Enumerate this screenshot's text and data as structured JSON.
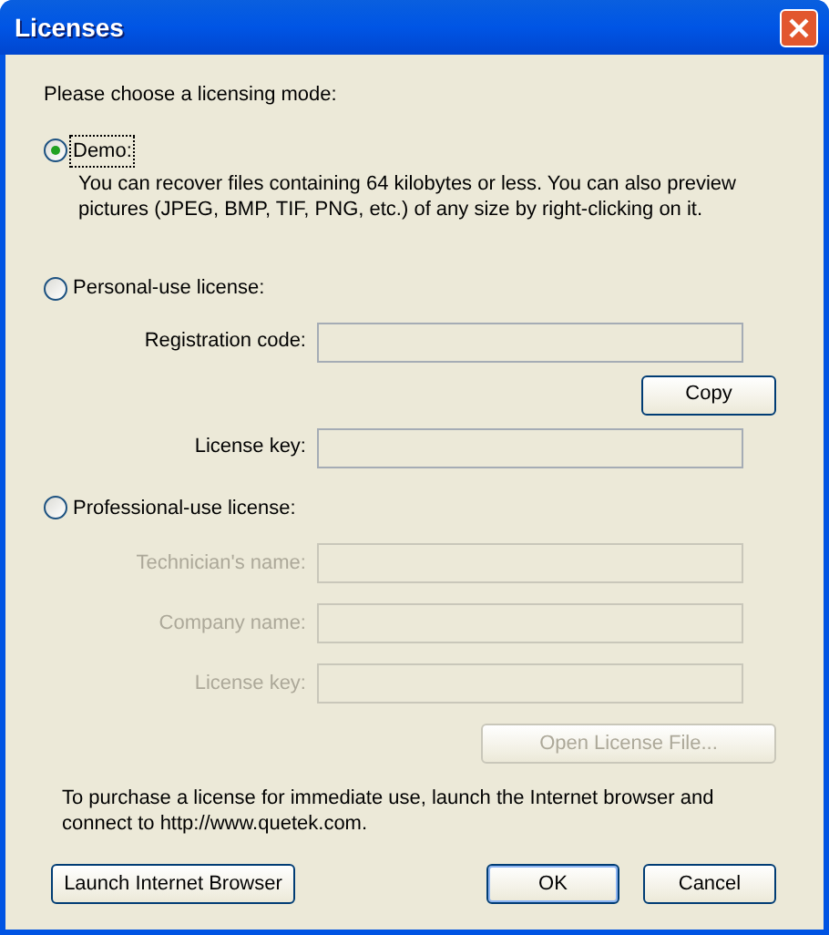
{
  "window": {
    "title": "Licenses"
  },
  "prompt": "Please choose a licensing mode:",
  "modes": [
    {
      "label": "Demo:",
      "selected": true,
      "focused": true,
      "description": "You can recover files containing 64 kilobytes or less. You can also preview pictures (JPEG, BMP, TIF, PNG, etc.) of any size by right-clicking on it."
    },
    {
      "label": "Personal-use license:",
      "selected": false,
      "focused": false,
      "fields": [
        {
          "label": "Registration code:",
          "disabled": false
        },
        {
          "kind": "button",
          "label": "Copy",
          "disabled": false
        },
        {
          "label": "License key:",
          "disabled": false
        }
      ]
    },
    {
      "label": "Professional-use license:",
      "selected": false,
      "focused": false,
      "fields": [
        {
          "label": "Technician's name:",
          "disabled": true
        },
        {
          "label": "Company name:",
          "disabled": true
        },
        {
          "label": "License key:",
          "disabled": true
        },
        {
          "kind": "button",
          "label": "Open License File...",
          "disabled": true
        }
      ]
    }
  ],
  "purchase_note": "To purchase a license for immediate use, launch the Internet browser and connect to http://www.quetek.com.",
  "buttons": [
    {
      "label": "Launch Internet Browser",
      "default": false
    },
    {
      "label": "OK",
      "default": true
    },
    {
      "label": "Cancel",
      "default": false
    }
  ]
}
